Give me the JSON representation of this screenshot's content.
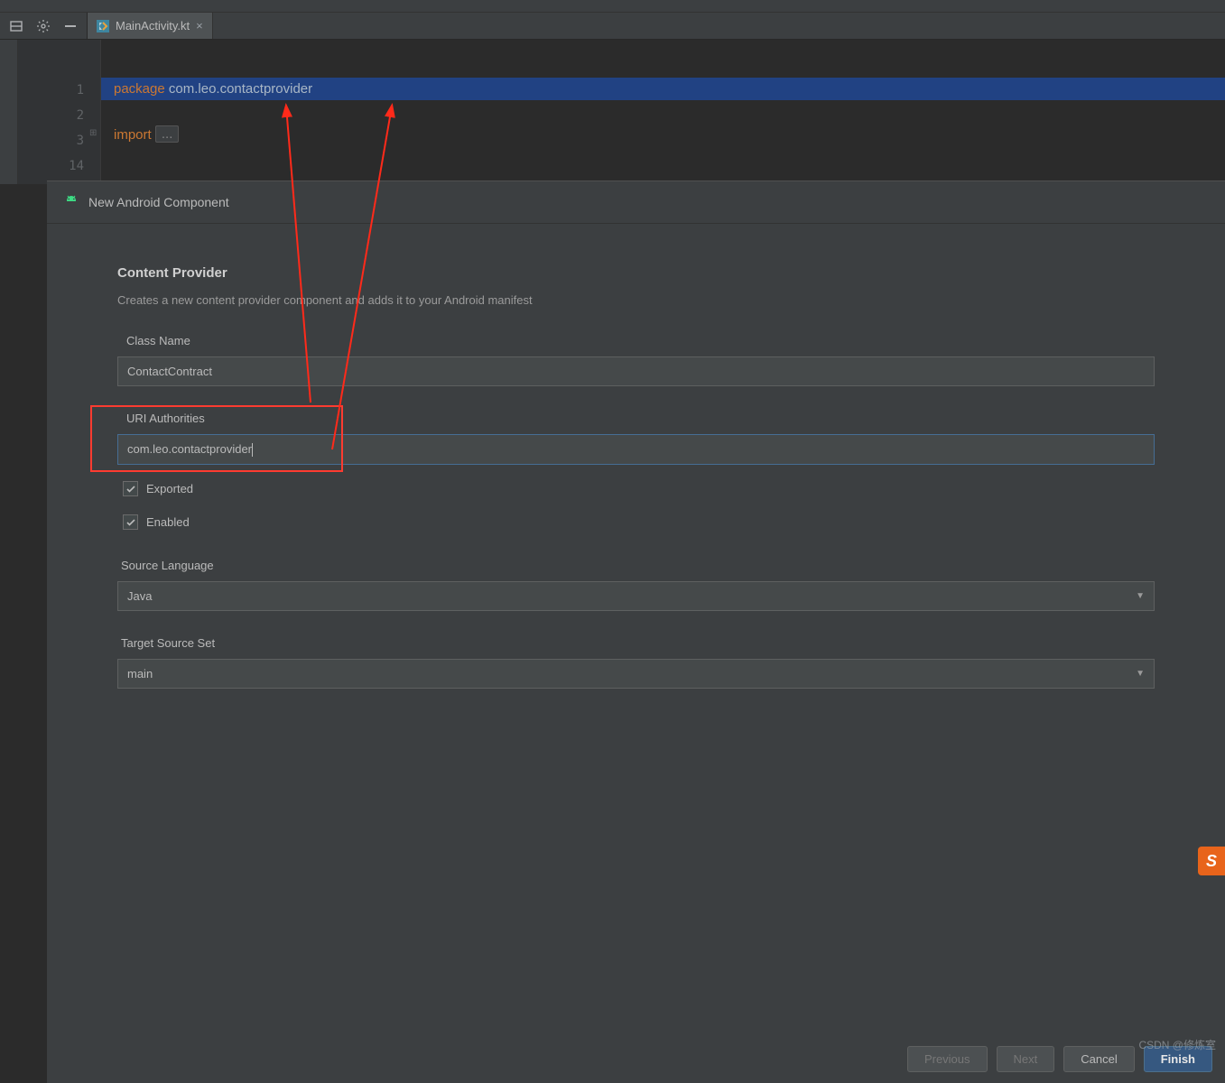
{
  "tab": {
    "label": "MainActivity.kt"
  },
  "gutter": [
    "1",
    "2",
    "3",
    "14"
  ],
  "code": {
    "package_kw": "package",
    "package_name": " com.leo.contactprovider",
    "import_kw": "import",
    "fold": "..."
  },
  "dialog": {
    "title": "New Android Component",
    "section_title": "Content Provider",
    "section_desc": "Creates a new content provider component and adds it to your Android manifest",
    "class_name_label": "Class Name",
    "class_name_value": "ContactContract",
    "uri_label": "URI Authorities",
    "uri_value": "com.leo.contactprovider",
    "exported_label": "Exported",
    "enabled_label": "Enabled",
    "source_lang_label": "Source Language",
    "source_lang_value": "Java",
    "target_set_label": "Target Source Set",
    "target_set_value": "main",
    "btn_previous": "Previous",
    "btn_next": "Next",
    "btn_cancel": "Cancel",
    "btn_finish": "Finish"
  },
  "watermark": "CSDN @修炼室",
  "badge": "S"
}
